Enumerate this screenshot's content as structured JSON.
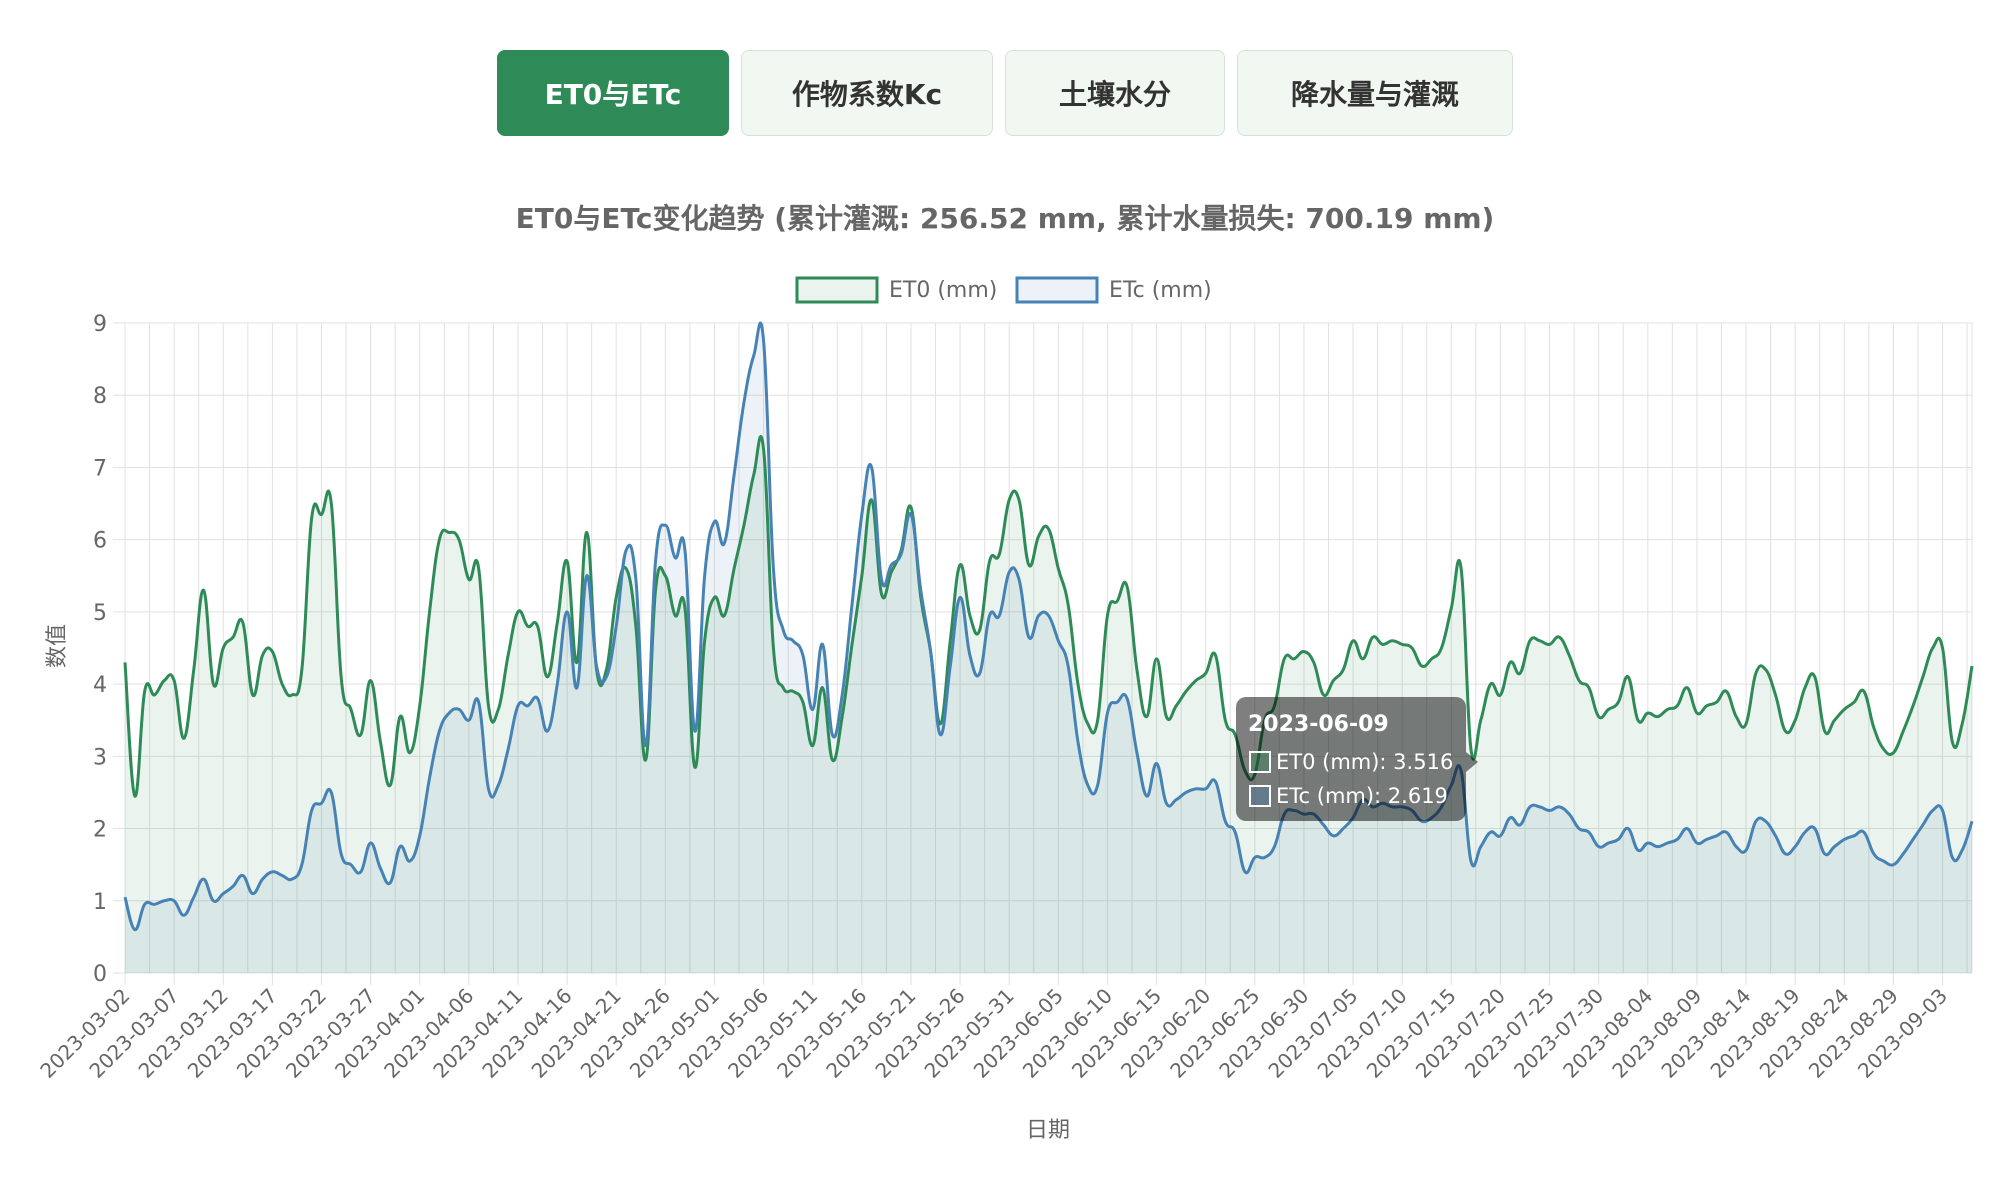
{
  "tabs": [
    {
      "label": "ET0与ETc",
      "active": true
    },
    {
      "label": "作物系数Kc",
      "active": false
    },
    {
      "label": "土壤水分",
      "active": false
    },
    {
      "label": "降水量与灌溉",
      "active": false
    }
  ],
  "chart_data": {
    "type": "area",
    "title": "ET0与ETc变化趋势 (累计灌溉: 256.52 mm, 累计水量损失: 700.19 mm)",
    "xlabel": "日期",
    "ylabel": "数值",
    "ylim": [
      0,
      9
    ],
    "yticks": [
      0,
      1,
      2,
      3,
      4,
      5,
      6,
      7,
      8,
      9
    ],
    "grid": true,
    "legend_position": "top-center",
    "x_start": "2023-03-02",
    "x_end": "2023-09-05",
    "x_tick_labels": [
      "2023-03-02",
      "2023-03-07",
      "2023-03-12",
      "2023-03-17",
      "2023-03-22",
      "2023-03-27",
      "2023-04-01",
      "2023-04-06",
      "2023-04-11",
      "2023-04-16",
      "2023-04-21",
      "2023-04-26",
      "2023-05-01",
      "2023-05-06",
      "2023-05-11",
      "2023-05-16",
      "2023-05-21",
      "2023-05-26",
      "2023-05-31",
      "2023-06-05",
      "2023-06-10",
      "2023-06-15",
      "2023-06-20",
      "2023-06-25",
      "2023-06-30",
      "2023-07-05",
      "2023-07-10",
      "2023-07-15",
      "2023-07-20",
      "2023-07-25",
      "2023-07-30",
      "2023-08-04",
      "2023-08-09",
      "2023-08-14",
      "2023-08-19",
      "2023-08-24",
      "2023-08-29",
      "2023-09-03"
    ],
    "series": [
      {
        "name": "ET0 (mm)",
        "color": "#2e8b57",
        "fill": "rgba(46,139,87,0.1)",
        "values": [
          4.3,
          2.45,
          3.9,
          3.85,
          4.05,
          4.05,
          3.25,
          4.2,
          5.3,
          4.0,
          4.5,
          4.65,
          4.85,
          3.85,
          4.4,
          4.45,
          4.0,
          3.85,
          4.2,
          6.3,
          6.35,
          6.5,
          4.1,
          3.65,
          3.3,
          4.05,
          3.2,
          2.6,
          3.55,
          3.05,
          3.7,
          5.0,
          6.0,
          6.1,
          6.0,
          5.45,
          5.6,
          3.7,
          3.65,
          4.4,
          5.0,
          4.8,
          4.8,
          4.1,
          4.85,
          5.7,
          4.3,
          6.1,
          4.2,
          4.2,
          5.2,
          5.6,
          4.8,
          2.95,
          5.3,
          5.5,
          4.95,
          5.05,
          2.85,
          4.6,
          5.2,
          4.95,
          5.6,
          6.2,
          6.9,
          7.25,
          4.5,
          3.95,
          3.9,
          3.75,
          3.15,
          3.95,
          2.95,
          3.55,
          4.55,
          5.5,
          6.55,
          5.25,
          5.55,
          5.85,
          6.45,
          5.2,
          4.45,
          3.45,
          4.6,
          5.65,
          4.95,
          4.75,
          5.7,
          5.8,
          6.55,
          6.55,
          5.65,
          6.05,
          6.15,
          5.6,
          5.1,
          4.0,
          3.45,
          3.5,
          4.95,
          5.15,
          5.35,
          4.2,
          3.55,
          4.35,
          3.55,
          3.7,
          3.9,
          4.05,
          4.15,
          4.4,
          3.5,
          3.3,
          2.8,
          2.75,
          3.5,
          3.7,
          4.35,
          4.35,
          4.45,
          4.3,
          3.85,
          4.05,
          4.2,
          4.6,
          4.35,
          4.65,
          4.55,
          4.6,
          4.55,
          4.5,
          4.25,
          4.35,
          4.5,
          5.05,
          5.6,
          3.1,
          3.5,
          4.0,
          3.85,
          4.3,
          4.15,
          4.6,
          4.6,
          4.55,
          4.65,
          4.4,
          4.05,
          3.95,
          3.55,
          3.65,
          3.75,
          4.1,
          3.5,
          3.6,
          3.55,
          3.65,
          3.7,
          3.95,
          3.6,
          3.7,
          3.75,
          3.9,
          3.55,
          3.45,
          4.15,
          4.2,
          3.85,
          3.35,
          3.5,
          3.95,
          4.1,
          3.35,
          3.5,
          3.65,
          3.75,
          3.9,
          3.4,
          3.1,
          3.05,
          3.35,
          3.7,
          4.1,
          4.5,
          4.5,
          3.2,
          3.45,
          4.25
        ]
      },
      {
        "name": "ETc (mm)",
        "color": "#4682b4",
        "fill": "rgba(70,130,180,0.1)",
        "values": [
          1.05,
          0.6,
          0.95,
          0.95,
          1.0,
          1.0,
          0.8,
          1.05,
          1.3,
          1.0,
          1.1,
          1.2,
          1.35,
          1.1,
          1.3,
          1.4,
          1.35,
          1.3,
          1.5,
          2.25,
          2.35,
          2.5,
          1.65,
          1.5,
          1.4,
          1.8,
          1.45,
          1.25,
          1.75,
          1.55,
          1.9,
          2.7,
          3.35,
          3.6,
          3.65,
          3.5,
          3.75,
          2.55,
          2.6,
          3.1,
          3.7,
          3.7,
          3.8,
          3.35,
          4.0,
          5.0,
          3.95,
          5.5,
          4.25,
          4.1,
          4.8,
          5.85,
          5.45,
          3.15,
          5.7,
          6.2,
          5.75,
          5.85,
          3.35,
          5.5,
          6.25,
          5.95,
          6.9,
          7.9,
          8.55,
          8.75,
          5.6,
          4.75,
          4.6,
          4.4,
          3.65,
          4.55,
          3.3,
          3.85,
          5.1,
          6.35,
          7.0,
          5.45,
          5.65,
          5.8,
          6.35,
          5.3,
          4.45,
          3.3,
          4.25,
          5.2,
          4.4,
          4.15,
          4.95,
          4.95,
          5.55,
          5.45,
          4.65,
          4.95,
          4.95,
          4.6,
          4.25,
          3.2,
          2.6,
          2.6,
          3.6,
          3.75,
          3.8,
          3.05,
          2.45,
          2.9,
          2.35,
          2.4,
          2.5,
          2.55,
          2.55,
          2.65,
          2.1,
          1.95,
          1.4,
          1.6,
          1.6,
          1.75,
          2.2,
          2.25,
          2.2,
          2.2,
          2.05,
          1.9,
          2.0,
          2.15,
          2.4,
          2.3,
          2.35,
          2.3,
          2.3,
          2.25,
          2.1,
          2.15,
          2.3,
          2.6,
          2.8,
          1.55,
          1.75,
          1.95,
          1.9,
          2.15,
          2.05,
          2.3,
          2.3,
          2.25,
          2.3,
          2.2,
          2.0,
          1.95,
          1.75,
          1.8,
          1.85,
          2.0,
          1.7,
          1.8,
          1.75,
          1.8,
          1.85,
          2.0,
          1.8,
          1.85,
          1.9,
          1.95,
          1.75,
          1.7,
          2.1,
          2.1,
          1.9,
          1.65,
          1.75,
          1.95,
          2.0,
          1.65,
          1.75,
          1.85,
          1.9,
          1.95,
          1.65,
          1.55,
          1.5,
          1.65,
          1.85,
          2.05,
          2.25,
          2.25,
          1.6,
          1.7,
          2.1
        ]
      }
    ],
    "tooltip": {
      "title": "2023-06-09",
      "lines": [
        "ET0 (mm): 3.516",
        "ETc (mm): 2.619"
      ]
    }
  }
}
